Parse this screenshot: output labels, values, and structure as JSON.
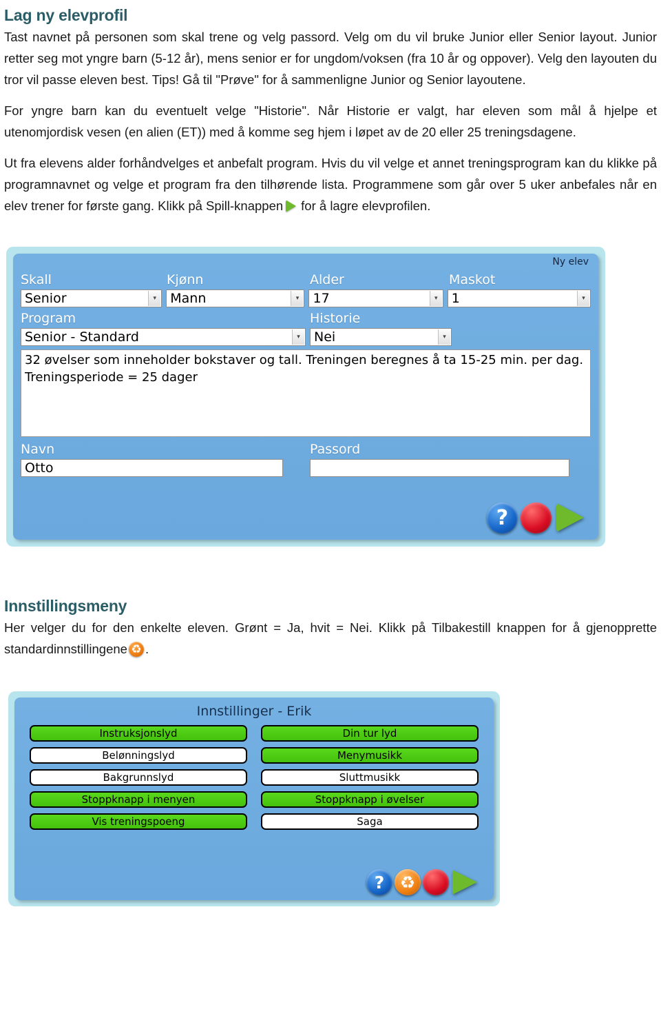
{
  "sections": {
    "profile": {
      "heading": "Lag ny elevprofil",
      "paragraph1_a": "Tast navnet på personen som skal trene og velg passord. Velg om du vil bruke Junior eller Senior layout. Junior retter seg mot yngre barn (5-12 år), mens senior er for ungdom/voksen (fra 10 år og oppover). Velg den layouten du tror vil passe eleven best. Tips! Gå til \"Prøve\" for å sammenligne Junior og Senior layoutene.",
      "paragraph2": "For yngre barn kan du eventuelt velge \"Historie\". Når Historie er valgt, har eleven som mål å hjelpe et utenomjordisk vesen (en alien (ET)) med å komme seg hjem i løpet av de 20 eller 25 treningsdagene.",
      "paragraph3_a": "Ut fra elevens alder forhåndvelges et anbefalt program. Hvis du vil velge et annet treningsprogram kan du klikke på programnavnet og velge et program fra den tilhørende lista. Programmene som går over 5 uker anbefales når en elev trener for første gang. Klikk på Spill-knappen",
      "paragraph3_b": "for å lagre elevprofilen."
    },
    "settings": {
      "heading": "Innstillingsmeny",
      "paragraph_a": "Her velger du for den enkelte eleven. Grønt = Ja, hvit = Nei. Klikk på Tilbakestill knappen for å gjenopprette standardinnstillingene",
      "paragraph_b": "."
    }
  },
  "profile_form": {
    "corner_label": "Ny elev",
    "labels": {
      "skall": "Skall",
      "kjonn": "Kjønn",
      "alder": "Alder",
      "maskot": "Maskot",
      "program": "Program",
      "historie": "Historie",
      "navn": "Navn",
      "passord": "Passord"
    },
    "values": {
      "skall": "Senior",
      "kjonn": "Mann",
      "alder": "17",
      "maskot": "1",
      "program": "Senior - Standard",
      "historie": "Nei",
      "navn": "Otto",
      "passord": ""
    },
    "description_line1": "32 øvelser som inneholder bokstaver og tall. Treningen beregnes å ta 15-25 min. per dag.",
    "description_line2": "Treningsperiode = 25 dager",
    "buttons": [
      {
        "name": "help",
        "glyph": "?"
      },
      {
        "name": "stop",
        "glyph": ""
      },
      {
        "name": "play",
        "glyph": ""
      }
    ]
  },
  "settings_panel": {
    "title": "Innstillinger - Erik",
    "toggles": [
      {
        "label": "Instruksjonslyd",
        "state": "on"
      },
      {
        "label": "Din tur lyd",
        "state": "on"
      },
      {
        "label": "Belønningslyd",
        "state": "off"
      },
      {
        "label": "Menymusikk",
        "state": "on"
      },
      {
        "label": "Bakgrunnslyd",
        "state": "off"
      },
      {
        "label": "Sluttmusikk",
        "state": "off"
      },
      {
        "label": "Stoppknapp i menyen",
        "state": "on"
      },
      {
        "label": "Stoppknapp i øvelser",
        "state": "on"
      },
      {
        "label": "Vis treningspoeng",
        "state": "on"
      },
      {
        "label": "Saga",
        "state": "off"
      }
    ],
    "buttons": [
      {
        "name": "help",
        "glyph": "?"
      },
      {
        "name": "recycle",
        "glyph": "♻"
      },
      {
        "name": "stop",
        "glyph": ""
      },
      {
        "name": "play",
        "glyph": ""
      }
    ]
  },
  "colors": {
    "heading": "#2b5d66",
    "panel_outer": "#b8e4ee",
    "panel_inner": "#6aa8dd",
    "toggle_on": "#4ecb16",
    "toggle_off": "#ffffff",
    "play_green": "#6fba2c",
    "stop_red": "#d90d24",
    "help_blue": "#1565c8",
    "recycle_orange": "#ef8012"
  }
}
